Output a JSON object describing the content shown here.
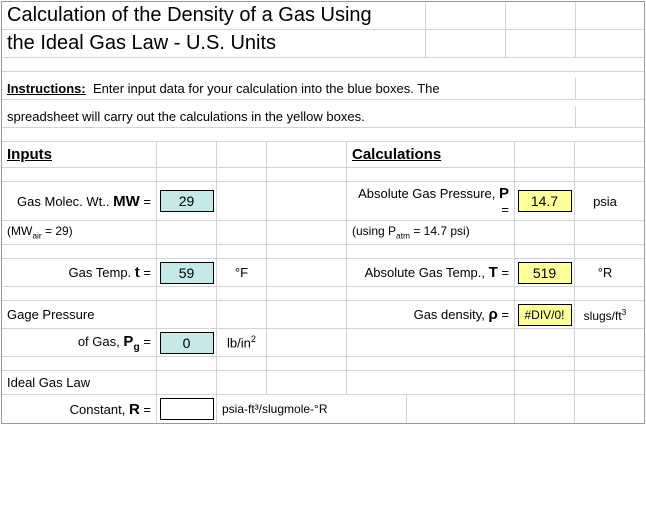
{
  "title_line1": "Calculation of the Density of a Gas Using",
  "title_line2": "the Ideal Gas Law  -  U.S. Units",
  "instructions_label": "Instructions:",
  "instructions_text1": "Enter input data for your calculation into the blue boxes.  The",
  "instructions_text2": "spreadsheet will carry out the calculations in the yellow boxes.",
  "inputs_header": "Inputs",
  "calculations_header": "Calculations",
  "mw_label_prefix": "Gas Molec. Wt.. ",
  "mw_symbol": "MW",
  "mw_eq": "  =",
  "mw_value": "29",
  "mw_note_prefix": "(MW",
  "mw_note_sub": "air",
  "mw_note_suffix": " = 29)",
  "p_label_prefix": "Absolute Gas Pressure, ",
  "p_symbol": "P",
  "p_eq": "  =",
  "p_value": "14.7",
  "p_unit": "psia",
  "p_note_prefix": "(using P",
  "p_note_sub": "atm",
  "p_note_suffix": " = 14.7 psi)",
  "t_label_prefix": "Gas Temp. ",
  "t_symbol": "t",
  "t_eq": "  =",
  "t_value": "59",
  "t_unit": "°F",
  "T_label_prefix": "Absolute Gas Temp., ",
  "T_symbol": "T",
  "T_eq": "  =",
  "T_value": "519",
  "T_unit": "°R",
  "pg_label1": "Gage Pressure",
  "pg_label2_prefix": "of Gas, ",
  "pg_symbol": "P",
  "pg_sub": "g",
  "pg_eq": "  =",
  "pg_value": "0",
  "pg_unit_prefix": "lb/in",
  "pg_unit_sup": "2",
  "rho_label_prefix": "Gas density, ",
  "rho_symbol": "ρ",
  "rho_eq": "  =",
  "rho_value": "#DIV/0!",
  "rho_unit_prefix": "slugs/ft",
  "rho_unit_sup": "3",
  "R_label1": "Ideal Gas Law",
  "R_label2_prefix": "Constant, ",
  "R_symbol": "R",
  "R_eq": "  =",
  "R_value": "",
  "R_unit": "psia-ft³/slugmole-°R"
}
